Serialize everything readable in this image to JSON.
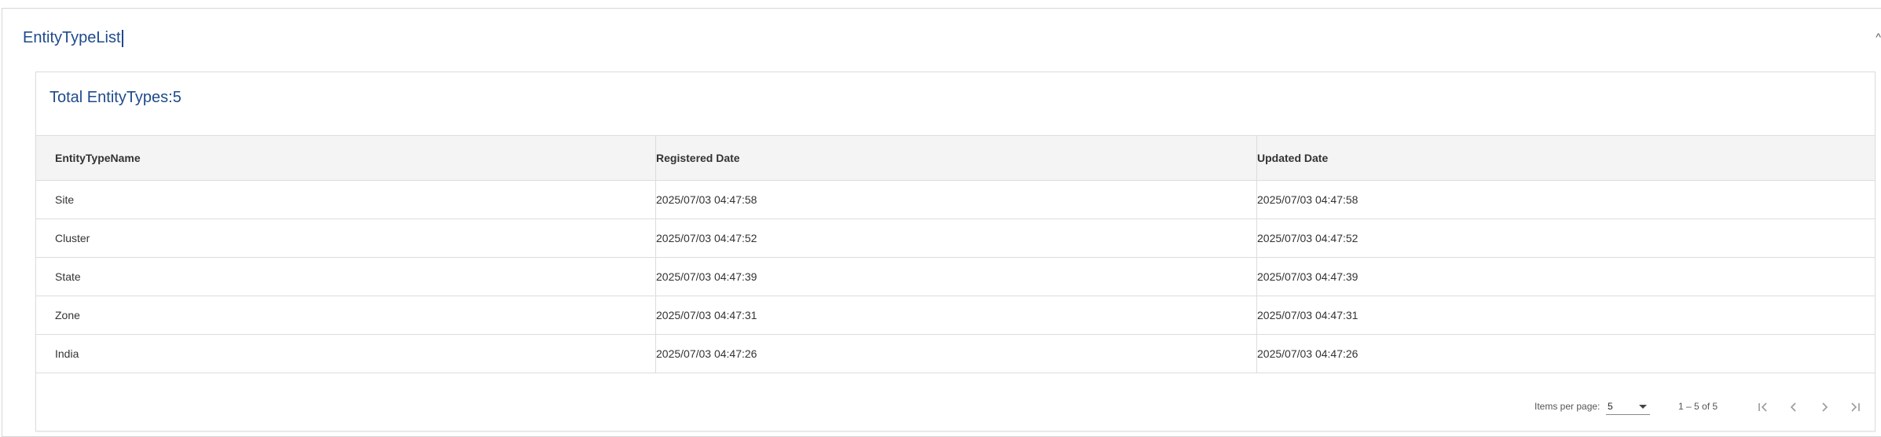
{
  "panel": {
    "title": "EntityTypeList",
    "collapse_icon": "chevron-up-icon"
  },
  "card": {
    "title": "Total EntityTypes:5"
  },
  "table": {
    "headers": [
      "EntityTypeName",
      "Registered Date",
      "Updated Date"
    ],
    "rows": [
      [
        "Site",
        "2025/07/03 04:47:58",
        "2025/07/03 04:47:58"
      ],
      [
        "Cluster",
        "2025/07/03 04:47:52",
        "2025/07/03 04:47:52"
      ],
      [
        "State",
        "2025/07/03 04:47:39",
        "2025/07/03 04:47:39"
      ],
      [
        "Zone",
        "2025/07/03 04:47:31",
        "2025/07/03 04:47:31"
      ],
      [
        "India",
        "2025/07/03 04:47:26",
        "2025/07/03 04:47:26"
      ]
    ]
  },
  "paginator": {
    "items_per_page_label": "Items per page:",
    "items_per_page_value": "5",
    "range_label": "1 – 5 of 5",
    "icons": [
      "first-page-icon",
      "previous-page-icon",
      "next-page-icon",
      "last-page-icon"
    ]
  },
  "colors": {
    "title_blue": "#1f4a8a",
    "header_bg": "#f4f4f4",
    "border": "#dcdcdc"
  }
}
